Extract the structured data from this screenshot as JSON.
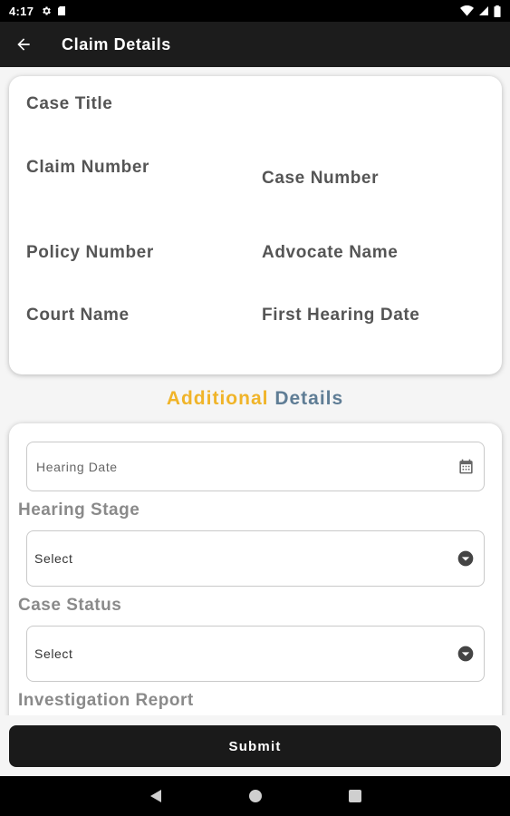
{
  "status_bar": {
    "time": "4:17"
  },
  "app_bar": {
    "title": "Claim Details"
  },
  "claim_card": {
    "case_title_label": "Case Title",
    "claim_number_label": "Claim Number",
    "case_number_label": "Case Number",
    "policy_number_label": "Policy Number",
    "advocate_name_label": "Advocate Name",
    "court_name_label": "Court Name",
    "first_hearing_date_label": "First Hearing Date"
  },
  "section": {
    "title_word1": "Additional",
    "title_word2": "Details"
  },
  "form": {
    "hearing_date_placeholder": "Hearing Date",
    "hearing_stage_label": "Hearing Stage",
    "hearing_stage_value": "Select",
    "case_status_label": "Case Status",
    "case_status_value": "Select",
    "investigation_report_label": "Investigation Report"
  },
  "submit_label": "Submit",
  "colors": {
    "accent_yellow": "#f0b429",
    "accent_blue": "#5f7d95",
    "dark": "#1c1c1c"
  }
}
